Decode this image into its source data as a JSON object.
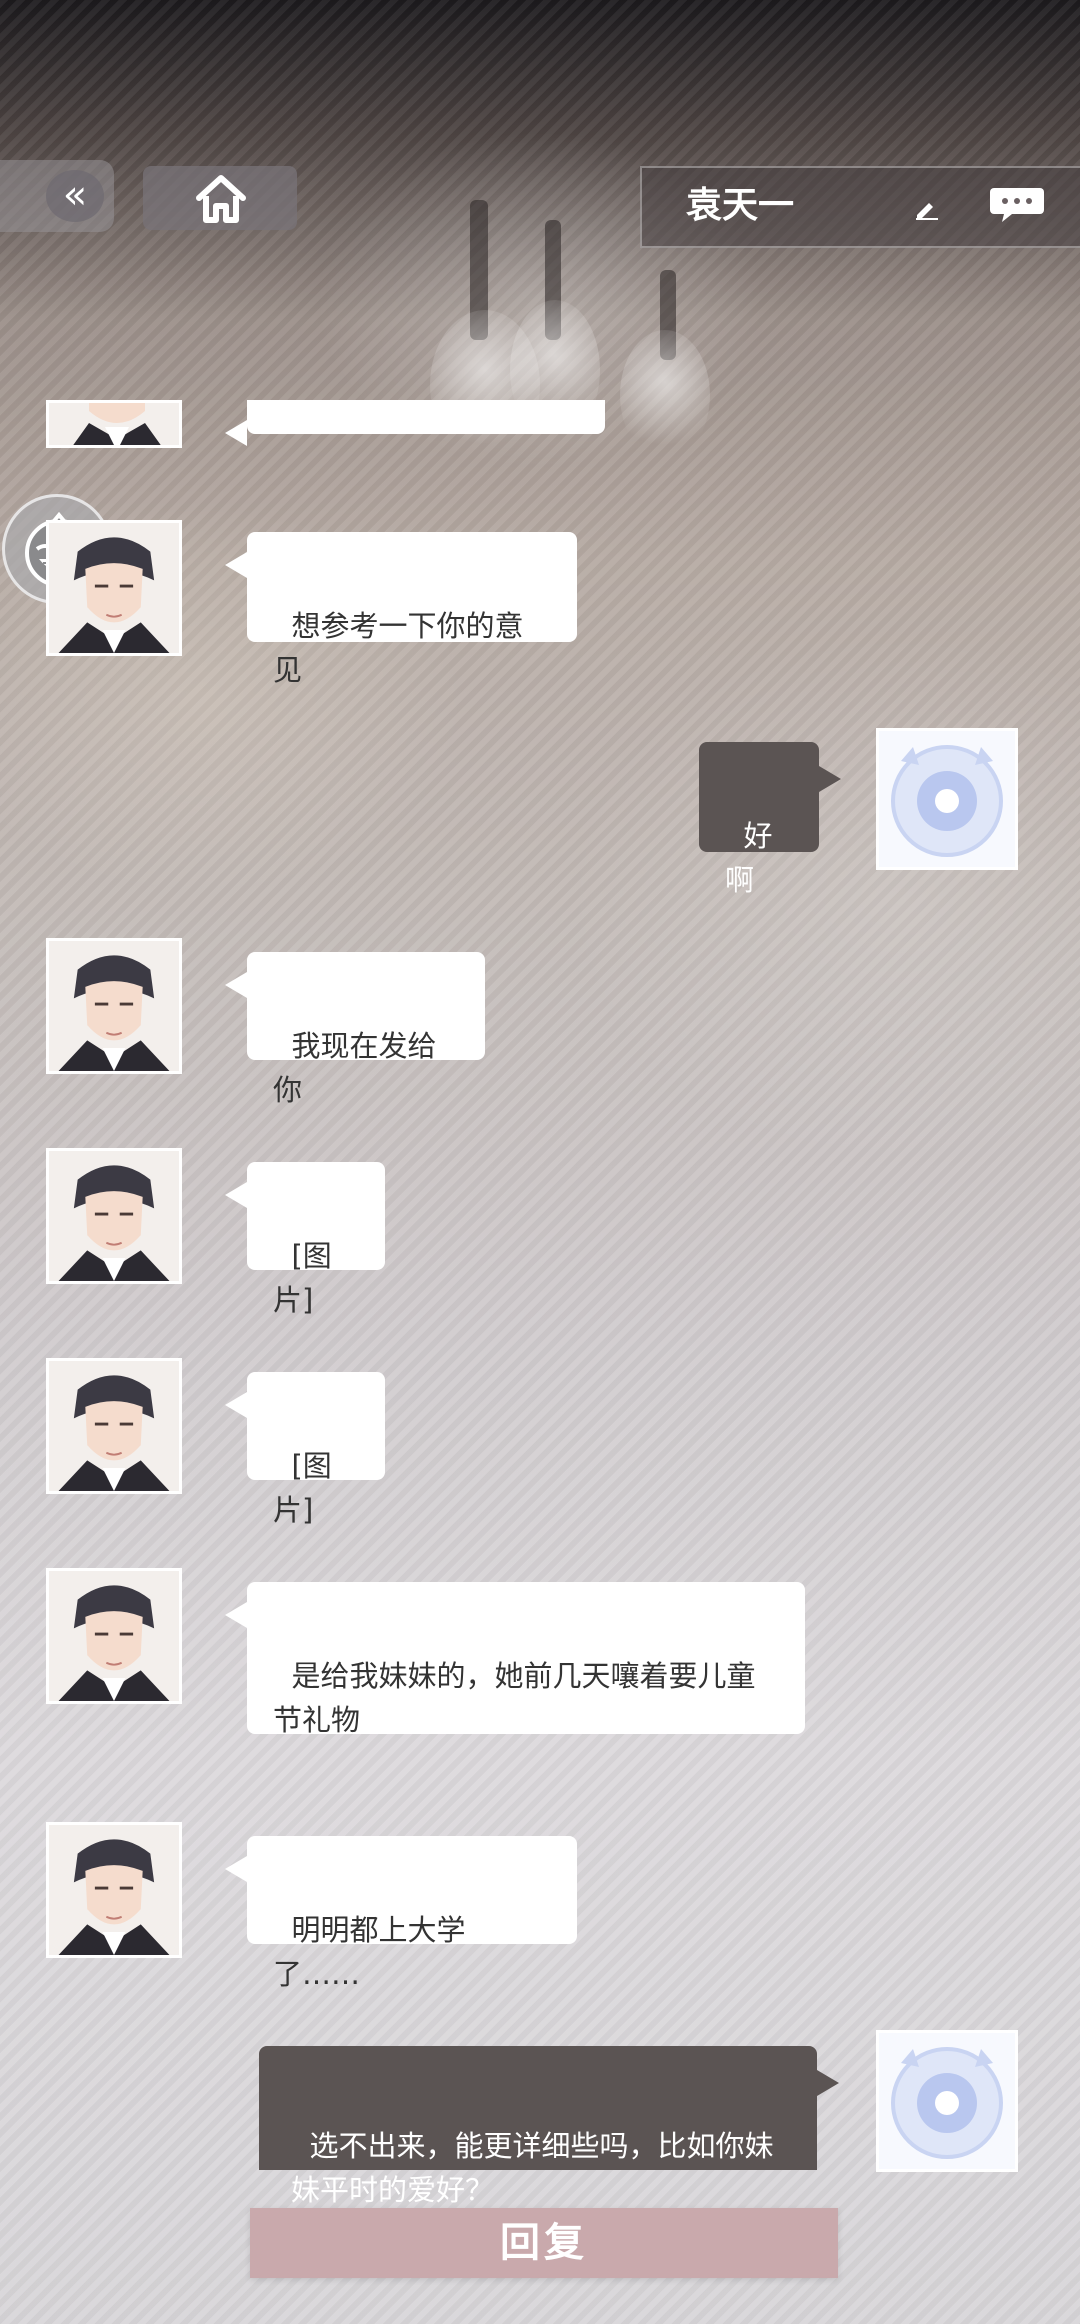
{
  "header": {
    "contact_name": "袁天一"
  },
  "icons": {
    "back": "double-chevron-left-icon",
    "home": "home-icon",
    "edit": "pencil-icon",
    "more": "chat-more-icon",
    "assistant": "grinning-face-icon"
  },
  "messages": [
    {
      "side": "left",
      "text": ""
    },
    {
      "side": "left",
      "text": "想参考一下你的意见"
    },
    {
      "side": "right",
      "text": "好啊"
    },
    {
      "side": "left",
      "text": "我现在发给你"
    },
    {
      "side": "left",
      "text": "[图片]"
    },
    {
      "side": "left",
      "text": "[图片]"
    },
    {
      "side": "left",
      "text": "是给我妹妹的，她前几天嚷着要儿童节礼物"
    },
    {
      "side": "left",
      "text": "明明都上大学了……"
    },
    {
      "side": "right",
      "text": "选不出来，能更详细些吗，比如你妹妹平时的爱好？"
    }
  ],
  "footer": {
    "reply_label": "回复"
  },
  "colors": {
    "reply_bar": "#c9a9ac",
    "my_bubble": "#5b5453",
    "npc_bubble": "#ffffff"
  }
}
